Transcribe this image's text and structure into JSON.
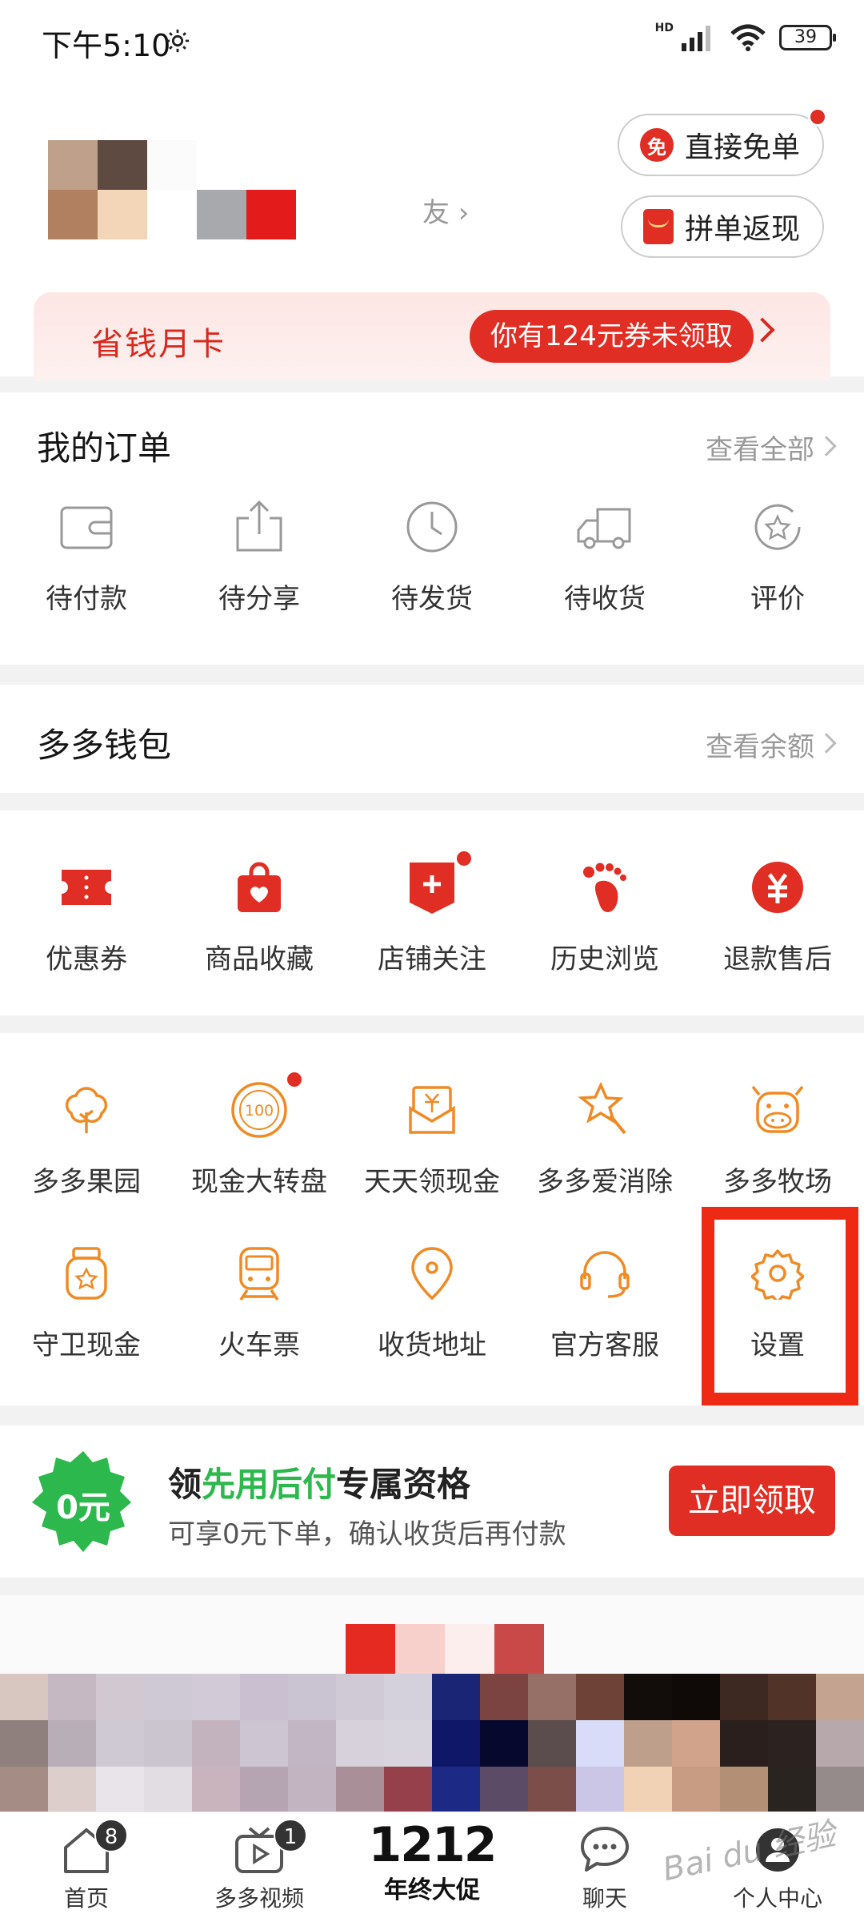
{
  "status": {
    "time": "下午5:10",
    "network": "HD",
    "battery": "39"
  },
  "header": {
    "friend_text": "友",
    "free_button": "直接免单",
    "free_icon": "免",
    "groupon_button": "拼单返现"
  },
  "savecard": {
    "title": "省钱月卡",
    "badge": "你有124元券未领取"
  },
  "orders": {
    "title": "我的订单",
    "more": "查看全部",
    "items": [
      {
        "label": "待付款",
        "icon": "wallet-icon"
      },
      {
        "label": "待分享",
        "icon": "share-icon"
      },
      {
        "label": "待发货",
        "icon": "clock-icon"
      },
      {
        "label": "待收货",
        "icon": "truck-icon"
      },
      {
        "label": "评价",
        "icon": "review-icon"
      }
    ]
  },
  "wallet": {
    "title": "多多钱包",
    "more": "查看余额"
  },
  "services": {
    "items": [
      {
        "label": "优惠券",
        "icon": "coupon-icon"
      },
      {
        "label": "商品收藏",
        "icon": "favorite-bag-icon"
      },
      {
        "label": "店铺关注",
        "icon": "store-follow-icon"
      },
      {
        "label": "历史浏览",
        "icon": "footprint-icon"
      },
      {
        "label": "退款售后",
        "icon": "refund-icon"
      }
    ]
  },
  "tools": {
    "row1": [
      {
        "label": "多多果园",
        "icon": "tree-icon"
      },
      {
        "label": "现金大转盘",
        "icon": "wheel-icon",
        "icon_text": "100"
      },
      {
        "label": "天天领现金",
        "icon": "cash-envelope-icon"
      },
      {
        "label": "多多爱消除",
        "icon": "star-wand-icon"
      },
      {
        "label": "多多牧场",
        "icon": "cow-icon"
      }
    ],
    "row2": [
      {
        "label": "守卫现金",
        "icon": "jar-icon"
      },
      {
        "label": "火车票",
        "icon": "train-icon"
      },
      {
        "label": "收货地址",
        "icon": "location-icon"
      },
      {
        "label": "官方客服",
        "icon": "headset-icon"
      },
      {
        "label": "设置",
        "icon": "settings-icon"
      }
    ]
  },
  "promo": {
    "badge": "0元",
    "title_prefix": "领",
    "title_highlight": "先用后付",
    "title_suffix": "专属资格",
    "subtitle": "可享0元下单，确认收货后再付款",
    "button": "立即领取"
  },
  "tabs": [
    {
      "label": "首页",
      "badge": "8",
      "icon": "home-icon"
    },
    {
      "label": "多多视频",
      "badge": "1",
      "icon": "video-icon"
    },
    {
      "label": "年终大促",
      "big": "1212"
    },
    {
      "label": "聊天",
      "icon": "chat-icon"
    },
    {
      "label": "个人中心",
      "icon": "person-icon"
    }
  ],
  "watermark": "Bai du 经验",
  "colors": {
    "brand_red": "#e02e24",
    "orange": "#f08a24",
    "green": "#2db84d"
  }
}
